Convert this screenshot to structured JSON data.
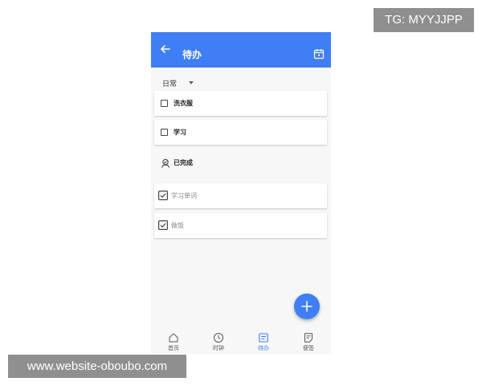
{
  "watermarks": {
    "top_right": "TG: MYYJJPP",
    "bottom_left": "www.website-oboubo.com"
  },
  "appbar": {
    "title": "待办",
    "back_icon": "arrow-left-icon",
    "calendar_icon": "calendar-icon"
  },
  "category": {
    "selected": "日常"
  },
  "todos": [
    {
      "label": "洗衣服",
      "checked": false
    },
    {
      "label": "学习",
      "checked": false
    }
  ],
  "completed_section": {
    "label": "已完成",
    "icon": "user-check-icon"
  },
  "completed": [
    {
      "label": "学习单词",
      "checked": true
    },
    {
      "label": "做饭",
      "checked": true
    }
  ],
  "fab": {
    "icon": "plus-icon"
  },
  "bottom_nav": [
    {
      "label": "首页",
      "icon": "home-icon",
      "active": false
    },
    {
      "label": "时钟",
      "icon": "clock-icon",
      "active": false
    },
    {
      "label": "待办",
      "icon": "todo-icon",
      "active": true
    },
    {
      "label": "便签",
      "icon": "note-icon",
      "active": false
    }
  ],
  "colors": {
    "primary": "#3f7ef4",
    "background": "#f7f7f7",
    "watermark": "#8f8f8f"
  }
}
